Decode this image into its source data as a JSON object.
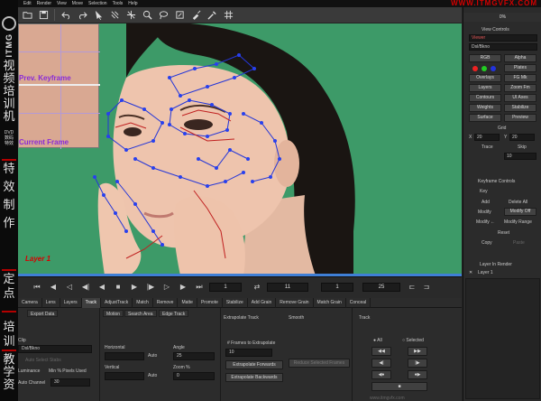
{
  "brand": {
    "logo_text": "ITMG",
    "chars_top": [
      "视",
      "频",
      "培",
      "训",
      "机",
      "构"
    ],
    "dvd_text": "DVD\n数码\n特效",
    "chars_mid": [
      "特",
      "效",
      "制",
      "作"
    ],
    "chars_low": [
      "定",
      "点",
      "培",
      "训"
    ],
    "chars_bottom": [
      "教",
      "学",
      "资",
      "源"
    ],
    "watermark": "WWW.ITMGVFX.COM"
  },
  "menu": [
    "Edit",
    "Render",
    "View",
    "Move",
    "Selection",
    "Tools",
    "Help"
  ],
  "toolbar_icons": [
    "folder-open-icon",
    "save-icon",
    "undo-icon",
    "redo-icon",
    "pointer-icon",
    "transform-icon",
    "move-point-icon",
    "zoom-icon",
    "lasso-icon",
    "paint-icon",
    "brush-icon",
    "eyedropper-icon",
    "grid-icon"
  ],
  "viewer": {
    "inset_prev": "Prev. Keyframe",
    "inset_curr": "Current Frame",
    "layer_label": "Layer 1"
  },
  "right_panel": {
    "progress": "0%",
    "view_controls": "View Controls",
    "color_mode": "Viewer",
    "clip_field": "Dsl/Bkno",
    "btns": [
      [
        "RGB",
        "Alpha"
      ],
      [
        "",
        "Plates"
      ],
      [
        "Overlays",
        "FG Mk"
      ],
      [
        "Layers",
        "Zoom Fm"
      ],
      [
        "Contours",
        "UI Axes"
      ],
      [
        "Weights",
        "Stabilize"
      ],
      [
        "Surface",
        "Preview"
      ]
    ],
    "grid_label": "Grid",
    "grid_x": "X",
    "grid_x_val": "20",
    "grid_y": "Y",
    "grid_y_val": "20",
    "trace": "Trace",
    "skip": "Skip",
    "skip_val": "10",
    "keyframe_controls": "Keyframe Controls",
    "key": "Key",
    "key_btns": [
      [
        "Add",
        "Delete All"
      ],
      [
        "Modify",
        "Modify Off"
      ],
      [
        "Modify ←",
        "Modify Range"
      ]
    ],
    "reset": "Reset",
    "copy": "Copy",
    "paste": "Paste",
    "layer_in_render": "Layer In Render",
    "layer_1": "Layer 1"
  },
  "transport": {
    "frame_start": "1",
    "frame_current": "11",
    "frame_mid": "1",
    "frame_end": "25",
    "frame_extra": "11"
  },
  "tabs": [
    "Camera",
    "Lens",
    "Layers",
    "Track",
    "AdjustTrack",
    "Match",
    "Remove",
    "Matte",
    "Promote",
    "Stabilize",
    "Add Grain",
    "Remove Grain",
    "Match Grain",
    "Conceal"
  ],
  "active_tab": "Track",
  "bottom": {
    "subtabs": [
      "Export Data",
      "Motion",
      "Search Area",
      "Edge Track"
    ],
    "clip_label": "Clip",
    "clip_value": "Dsl/Bkno",
    "auto_select": "Auto Select Stabs",
    "luminance": "Luminance",
    "min_pixels": "Min % Pixels Used",
    "auto_channel": "Auto Channel",
    "auto_channel_val": "30",
    "horizontal": "Horizontal",
    "vertical": "Vertical",
    "auto": "Auto",
    "angle": "Angle",
    "angle_val": "25",
    "zoom": "Zoom %",
    "zoom_val": "0",
    "extrapolate_track": "Extrapolate Track",
    "frames_extrap": "# Frames to Extrapolate",
    "frames_extrap_val": "10",
    "extrap_fwd": "Extrapolate Forwards",
    "extrap_bwd": "Extrapolate Backwards",
    "reduce_btn": "Reduce Selected Frames",
    "smooth": "Smooth",
    "track": "Track",
    "all": "All",
    "selected": "Selected"
  },
  "footer_watermark": "www.itmgvfx.com"
}
